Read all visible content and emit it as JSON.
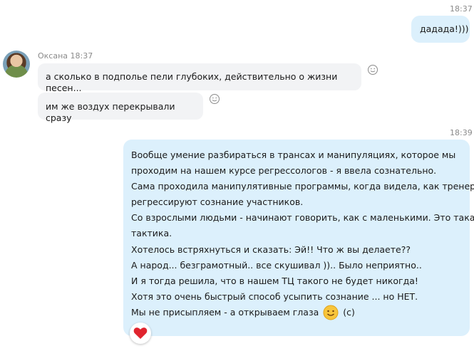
{
  "messages": [
    {
      "time": "18:37",
      "text": "дадада!)))"
    },
    {
      "sender": "Оксана",
      "time": "18:37",
      "texts": [
        "а сколько в подполье пели глубоких, действительно о жизни песен...",
        "им же воздух перекрывали сразу"
      ]
    },
    {
      "time": "18:39",
      "lines": [
        "Вообще умение разбираться в трансах и манипуляциях, которое мы",
        "проходим на нашем курсе регрессологов - я ввела сознательно.",
        "Сама проходила манипулятивные программы, когда видела, как тренеры",
        "регрессируют сознание участников.",
        "Со взрослыми людьми - начинают говорить, как с маленькими. Это такая",
        "тактика.",
        "Хотелось встряхнуться и сказать: Эй!! Что ж вы делаете??",
        "А народ... безграмотный.. все скушивал )).. Было неприятно..",
        "И я тогда решила, что в нашем ТЦ такого не будет никогда!",
        "Хотя это очень быстрый способ усыпить сознание ... но НЕТ.",
        "Мы не присыпляем - а открываем глаза"
      ],
      "last_suffix": "(с)"
    }
  ],
  "icons": {
    "reaction": "smiley-icon",
    "emoji": "smiling-face-icon",
    "like": "heart-icon"
  },
  "colors": {
    "outgoing_bubble": "#dcf0fc",
    "incoming_bubble": "#f2f3f5",
    "heart": "#e0242e"
  }
}
